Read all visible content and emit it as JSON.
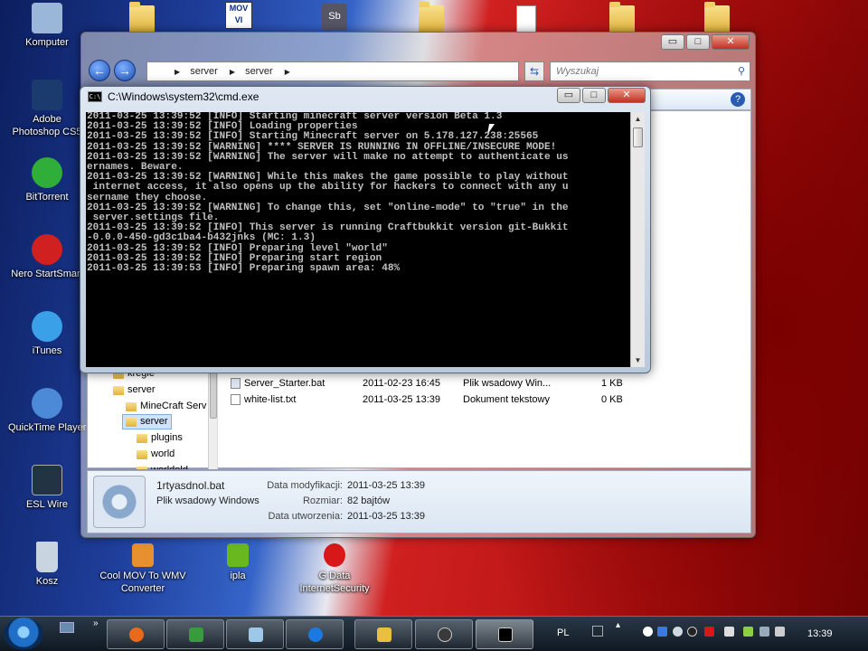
{
  "desktop": {
    "left_icons": [
      {
        "label": "Komputer",
        "icon": "computer-icon",
        "color": "#9ab6d8"
      },
      {
        "label": "Adobe Photoshop CS5",
        "icon": "photoshop-icon",
        "color": "#1b3a6e"
      },
      {
        "label": "BitTorrent",
        "icon": "bittorrent-icon",
        "color": "#2fae3a"
      },
      {
        "label": "Nero StartSmart",
        "icon": "nero-icon",
        "color": "#d02020"
      },
      {
        "label": "iTunes",
        "icon": "itunes-icon",
        "color": "#3aa0e8"
      },
      {
        "label": "QuickTime Player",
        "icon": "quicktime-icon",
        "color": "#4c8ad8"
      },
      {
        "label": "ESL Wire",
        "icon": "esl-wire-icon",
        "color": "#223344"
      },
      {
        "label": "Kosz",
        "icon": "recycle-bin-icon",
        "color": "#c8d4e0"
      }
    ],
    "bottom_icons": [
      {
        "label": "Cool MOV To WMV Converter",
        "icon": "converter-icon",
        "color": "#e89030"
      },
      {
        "label": "ipla",
        "icon": "ipla-icon",
        "color": "#6ab820"
      },
      {
        "label": "G Data InternetSecurity",
        "icon": "gdata-icon",
        "color": "#d81818"
      }
    ],
    "top_row_icons": [
      {
        "icon": "folder-icon"
      },
      {
        "icon": "mov-file-icon",
        "text": "MOV VI"
      },
      {
        "icon": "sb-file-icon",
        "text": "Sb"
      },
      {
        "icon": "folder-icon"
      },
      {
        "icon": "document-icon"
      },
      {
        "icon": "folder-icon"
      },
      {
        "icon": "folder-icon"
      }
    ]
  },
  "explorer": {
    "address": {
      "crumbs": [
        "server",
        "server"
      ]
    },
    "search_placeholder": "Wyszukaj",
    "controls": {
      "minimize": "▭",
      "maximize": "□",
      "close": "✕"
    },
    "nav_tree": [
      {
        "label": "kregle"
      },
      {
        "label": "server"
      },
      {
        "label": "MineCraft Serv"
      },
      {
        "label": "server",
        "selected": true
      },
      {
        "label": "plugins"
      },
      {
        "label": "world"
      },
      {
        "label": "worldold"
      }
    ],
    "files": [
      {
        "name": "Server_Starter.bat",
        "date": "2011-02-23 16:45",
        "type": "Plik wsadowy Win...",
        "size": "1 KB"
      },
      {
        "name": "white-list.txt",
        "date": "2011-03-25 13:39",
        "type": "Dokument tekstowy",
        "size": "0 KB"
      }
    ],
    "details": {
      "name": "1rtyasdnol.bat",
      "type": "Plik wsadowy Windows",
      "modified_label": "Data modyfikacji:",
      "modified_value": "2011-03-25 13:39",
      "size_label": "Rozmiar:",
      "size_value": "82 bajtów",
      "created_label": "Data utworzenia:",
      "created_value": "2011-03-25 13:39"
    }
  },
  "cmd": {
    "title": "C:\\Windows\\system32\\cmd.exe",
    "icon_text": "C:\\",
    "controls": {
      "minimize": "▭",
      "maximize": "□",
      "close": "✕"
    },
    "lines": [
      "2011-03-25 13:39:52 [INFO] Starting minecraft server version Beta 1.3",
      "2011-03-25 13:39:52 [INFO] Loading properties",
      "2011-03-25 13:39:52 [INFO] Starting Minecraft server on 5.178.127.238:25565",
      "2011-03-25 13:39:52 [WARNING] **** SERVER IS RUNNING IN OFFLINE/INSECURE MODE!",
      "2011-03-25 13:39:52 [WARNING] The server will make no attempt to authenticate us",
      "ernames. Beware.",
      "2011-03-25 13:39:52 [WARNING] While this makes the game possible to play without",
      " internet access, it also opens up the ability for hackers to connect with any u",
      "sername they choose.",
      "2011-03-25 13:39:52 [WARNING] To change this, set \"online-mode\" to \"true\" in the",
      " server.settings file.",
      "2011-03-25 13:39:52 [INFO] This server is running Craftbukkit version git-Bukkit",
      "-0.0.0-450-gd3c1ba4-b432jnks (MC: 1.3)",
      "2011-03-25 13:39:52 [INFO] Preparing level \"world\"",
      "2011-03-25 13:39:52 [INFO] Preparing start region",
      "2011-03-25 13:39:53 [INFO] Preparing spawn area: 48%"
    ]
  },
  "taskbar": {
    "buttons": [
      {
        "icon": "firefox-icon",
        "color": "#e86a1a"
      },
      {
        "icon": "photo-app-icon",
        "color": "#3a9a40"
      },
      {
        "icon": "notepad-icon",
        "color": "#9ec8e8"
      },
      {
        "icon": "browser-icon",
        "color": "#1a7ae0"
      },
      {
        "icon": "explorer-folder-icon",
        "color": "#e8c040"
      },
      {
        "icon": "steam-icon",
        "color": "#3a3a3a"
      },
      {
        "icon": "cmd-icon",
        "color": "#000000",
        "active": true
      }
    ],
    "language": "PL",
    "clock": "13:39"
  }
}
